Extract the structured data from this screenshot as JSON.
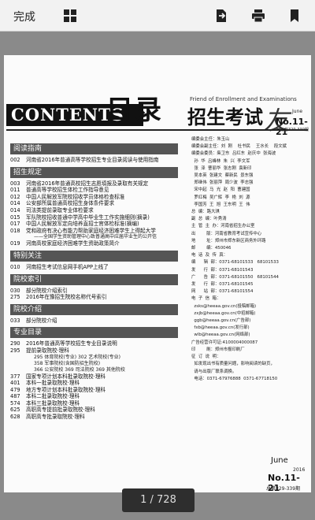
{
  "toolbar": {
    "done_label": "完成",
    "icons": [
      "grid-icon",
      "share-icon",
      "print-icon",
      "bookmark-icon"
    ]
  },
  "magazine": {
    "contents_label": "CONTENTS",
    "mulu_label": "目录",
    "english_subtitle": "Friend of Enrollment and Examinations",
    "title_cn": "招生考试",
    "title_you": "友",
    "month_small": "June",
    "year_small": "2016",
    "issue_number": "No.11-21",
    "total_issue_small": "总第329-339期",
    "sections": [
      {
        "title": "阅读指南",
        "items": [
          {
            "n": "002",
            "t": "河南省2016年普通高等学校招生专业目录阅读与使用指南"
          }
        ]
      },
      {
        "title": "招生规定",
        "items": [
          {
            "n": "003",
            "t": "河南省2016年普通高校招生志愿填报及录取有关规定"
          },
          {
            "n": "011",
            "t": "普通高等学校招生体检工作指导意见"
          },
          {
            "n": "012",
            "t": "中国人民解放军院校招收学员体格检查标准"
          },
          {
            "n": "014",
            "t": "公安部所属普通高校招生身体条件要求"
          },
          {
            "n": "014",
            "t": "司法类提前录取专业体检要求"
          },
          {
            "n": "015",
            "t": "军队院校招收普通中学高中毕业生工作实施细则(摘录)"
          },
          {
            "n": "017",
            "t": "中国人民解放军定向培养直招士官体检标准(摘编)"
          },
          {
            "n": "018",
            "t": "党和政府有决心有能力帮助家庭经济困难学生上得起大学"
          },
          {
            "n": "",
            "t": "——全国学生资助管理中心致普通高中应届毕业生的公开信",
            "sub": true
          },
          {
            "n": "019",
            "t": "河南高校家庭经济困难学生资助政策简介"
          }
        ]
      },
      {
        "title": "特别关注",
        "items": [
          {
            "n": "010",
            "t": "河南招生考试信息网手机APP上线了"
          }
        ]
      },
      {
        "title": "院校索引",
        "items": [
          {
            "n": "030",
            "t": "部分院校介绍索引"
          },
          {
            "n": "275",
            "t": "2016年在豫招生院校名称代号索引"
          }
        ]
      },
      {
        "title": "院校介绍",
        "items": [
          {
            "n": "033",
            "t": "部分院校介绍"
          }
        ]
      },
      {
        "title": "专业目录",
        "items": [
          {
            "n": "290",
            "t": "2016年普通高等学校招生专业目录说明"
          },
          {
            "n": "295",
            "t": "提前录取院校·理科"
          },
          {
            "n": "",
            "t": "295  体育院校(专业)   302  艺术院校(专业)",
            "sub": true
          },
          {
            "n": "",
            "t": "358  军事院校(含国防招生院校)",
            "sub": true
          },
          {
            "n": "",
            "t": "366  公安院校   369  司法院校   369  其他院校",
            "sub": true
          },
          {
            "n": "377",
            "t": "国家专项计划本科批录取院校·理科"
          },
          {
            "n": "401",
            "t": "本科一批录取院校·理科"
          },
          {
            "n": "479",
            "t": "地方专项计划本科批录取院校·理科"
          },
          {
            "n": "487",
            "t": "本科二批录取院校·理科"
          },
          {
            "n": "574",
            "t": "本科三批录取院校·理科"
          },
          {
            "n": "625",
            "t": "高职高专提前批录取院校·理科"
          },
          {
            "n": "628",
            "t": "高职高专批录取院校·理科"
          }
        ]
      }
    ],
    "masthead": [
      "编委会主任：朱玉山",
      "编委会副主任：刘  刚    杜书民    王水长    段文斌",
      "编委会委员：柴卫东  吕红东  赵庆中  张海波",
      "  孙  华  吕峰林  朱  兴  李文军",
      "  张  泽  曹丽华  张志刚  袁新印",
      "  吴本英  张建文  蔡新民  景东强",
      "  郑继伟  张丽萍  周少波  李志强",
      "  宋中起  马  光  赵  阳  曹建国",
      "  罗红梅  吴广辉  李  艳  刘  源",
      "  李国芳  王  旭  王东明  王  伟",
      "",
      "总  编：路大琪",
      "副  总  编：叶秀清",
      "",
      "主  管  主  办：河南省招生办公室",
      "出        版：河南省教育考试宣传中心",
      "地        址：郑州市郑东新区商务外环路",
      "邮        编：450046",
      "",
      "电  话  及  传  真：",
      "编      辑  部：0371-68101533   68101533",
      "发      行  部：0371-68101543",
      "广      告  部：0371-68101550   68101544",
      "发      行  部：0371-68101545",
      "网      站  部：0371-68101554",
      "",
      "电  子  信  箱：",
      "  zsks@heeaa.gov.cn(投稿邮箱)",
      "  zxjb@heeaa.gov.cn(中招邮箱)",
      "  ggb@heeaa.gov.cn(广告部)",
      "  fxb@heeaa.gov.cn(发行部)",
      "  wlb@heeaa.gov.cn(网络部)",
      "",
      "广告经营许可证:4100004000087",
      "",
      "印        刷：郑州市报印刷厂",
      "",
      "征  订  说  明：",
      "  如发现出书有质量问题，影响阅读的缺页，",
      "  请与出版厂联系调换。",
      "  电话：0371-67976888  0371-67718150"
    ],
    "footer_month": "June",
    "footer_year": "2016",
    "footer_issue": "No.11-21",
    "footer_total": "总第329-339期"
  },
  "pager": {
    "current": "1",
    "total": "728",
    "label": "1 / 728"
  }
}
